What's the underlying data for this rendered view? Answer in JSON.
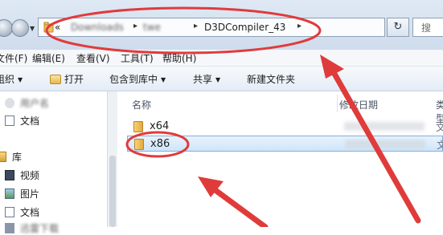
{
  "address": {
    "overflow": "«",
    "seg1": "Downloads",
    "seg2": "twe",
    "current": "D3DCompiler_43",
    "search_placeholder": "搜"
  },
  "menu": [
    "文件(F)",
    "编辑(E)",
    "查看(V)",
    "工具(T)",
    "帮助(H)"
  ],
  "toolbar": {
    "organize": "组织",
    "open": "打开",
    "include": "包含到库中",
    "share": "共享",
    "new_folder": "新建文件夹"
  },
  "nav": {
    "user": "用户名",
    "docs1": "文档",
    "library": "库",
    "videos": "视频",
    "pictures": "图片",
    "docs2": "文档",
    "music": "迅雷下载"
  },
  "columns": {
    "name": "名称",
    "date": "修改日期",
    "type": "类型"
  },
  "files": [
    {
      "name": "x64",
      "type": "文"
    },
    {
      "name": "x86",
      "type": "文"
    }
  ],
  "colors": {
    "annotation": "#e03b3b",
    "selection": "#cfe5fa",
    "address_bg": "#dfe9f5"
  },
  "annotations": {
    "circle_address": true,
    "circle_x86": true,
    "arrow_address": true,
    "arrow_x86": true
  }
}
